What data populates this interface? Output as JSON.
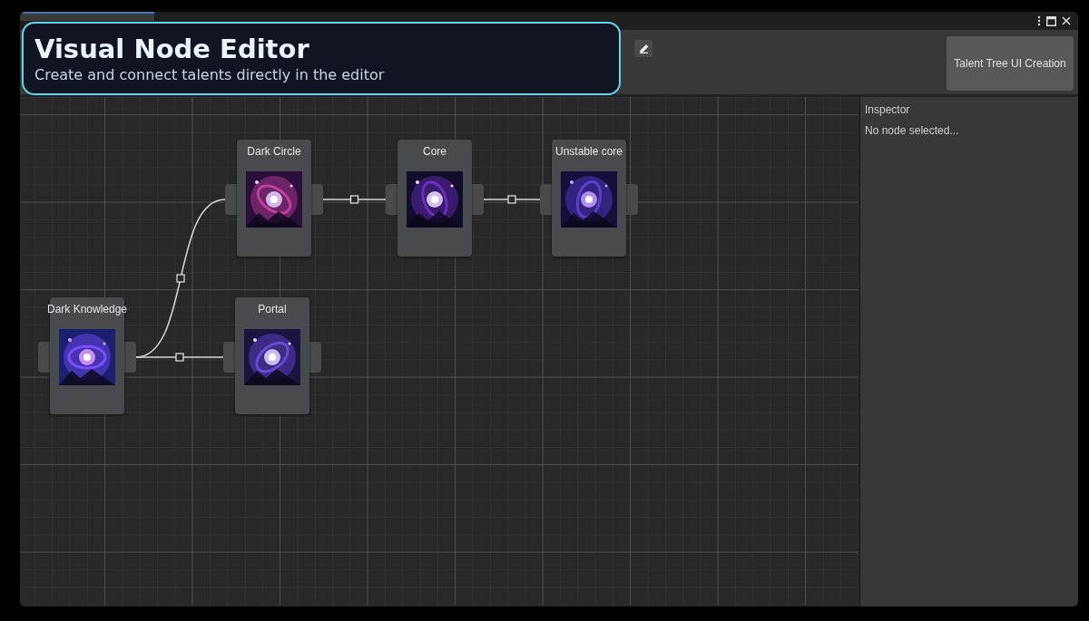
{
  "overlay": {
    "title": "Visual Node Editor",
    "subtitle": "Create and connect talents directly in the editor"
  },
  "toolbar": {
    "side_button": "Talent Tree UI Creation"
  },
  "nodes": [
    {
      "title": "Dark Knowledge",
      "children": [
        {
          "title": "Dark Circle",
          "children": [
            {
              "title": "Core",
              "children": [
                {
                  "title": "Unstable core"
                }
              ]
            }
          ]
        },
        {
          "title": "Portal"
        }
      ]
    }
  ],
  "inspector": {
    "title": "Inspector",
    "message": "No node selected..."
  }
}
